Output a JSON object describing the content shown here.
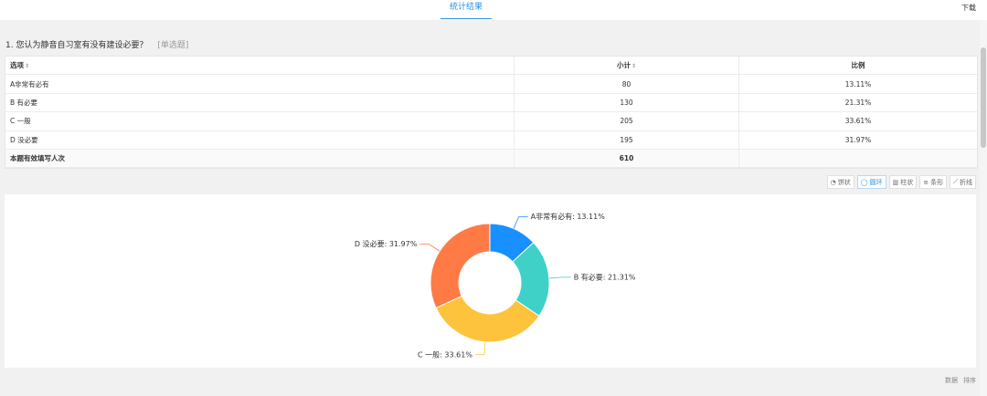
{
  "tabs": {
    "active": "统计结果",
    "download": "下载"
  },
  "question": {
    "title": "1. 您认为静音自习室有没有建设必要？",
    "type": "[单选题]"
  },
  "table": {
    "headers": {
      "option": "选项",
      "count": "小计",
      "ratio": "比例"
    },
    "rows": [
      {
        "option": "A非常有必有",
        "count": "80",
        "ratio": "13.11%"
      },
      {
        "option": "B 有必要",
        "count": "130",
        "ratio": "21.31%"
      },
      {
        "option": "C 一般",
        "count": "205",
        "ratio": "33.61%"
      },
      {
        "option": "D 没必要",
        "count": "195",
        "ratio": "31.97%"
      }
    ],
    "total": {
      "label": "本题有效填写人次",
      "count": "610"
    }
  },
  "toolbar": {
    "pie": "饼状",
    "donut": "圆环",
    "bar": "柱状",
    "hbar": "条形",
    "line": "折线"
  },
  "bottom": {
    "data": "数据",
    "sort": "排序"
  },
  "colors": {
    "accent": "#2b92e4",
    "slice_a": "#1890ff",
    "slice_b": "#3fd1c7",
    "slice_c": "#fec33d",
    "slice_d": "#ff7a45"
  },
  "chart_data": {
    "type": "pie",
    "donut": true,
    "labels": [
      "A非常有必有",
      "B 有必要",
      "C 一般",
      "D 没必要"
    ],
    "values": [
      13.11,
      21.31,
      33.61,
      31.97
    ],
    "label_texts": [
      "A非常有必有: 13.11%",
      "B 有必要: 21.31%",
      "C 一般: 33.61%",
      "D 没必要: 31.97%"
    ]
  }
}
